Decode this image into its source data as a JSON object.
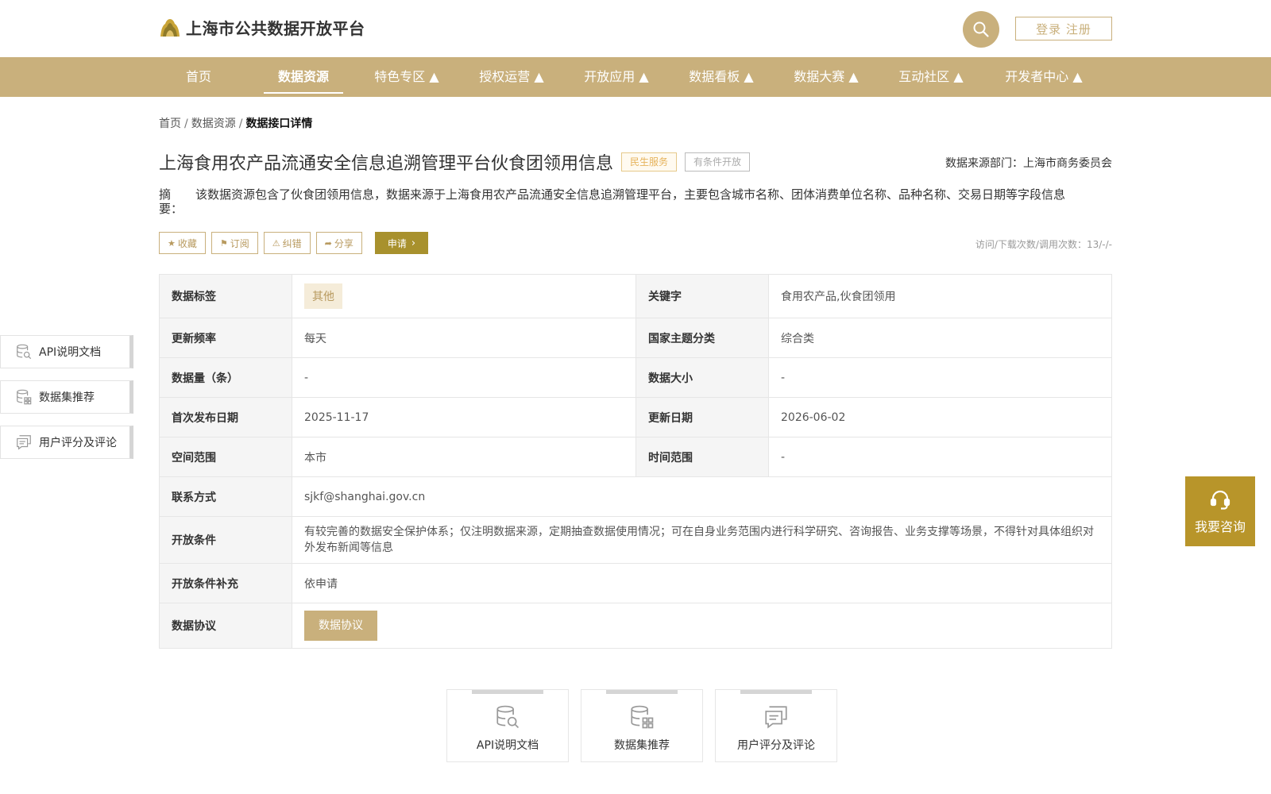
{
  "header": {
    "logo_text": "上海市公共数据开放平台",
    "login_label": "登录 注册"
  },
  "nav": {
    "items": [
      {
        "label": "首页"
      },
      {
        "label": "数据资源"
      },
      {
        "label": "特色专区 ▲"
      },
      {
        "label": "授权运营 ▲"
      },
      {
        "label": "开放应用 ▲"
      },
      {
        "label": "数据看板 ▲"
      },
      {
        "label": "数据大赛 ▲"
      },
      {
        "label": "互动社区 ▲"
      },
      {
        "label": "开发者中心 ▲"
      }
    ]
  },
  "breadcrumb": {
    "home": "首页",
    "resources": "数据资源",
    "current": "数据接口详情",
    "separator": "/"
  },
  "detail": {
    "title": "上海食用农产品流通安全信息追溯管理平台伙食团领用信息",
    "tag_service": "民生服务",
    "tag_open": "有条件开放",
    "source": "数据来源部门：上海市商务委员会",
    "summary_label": "摘 要：",
    "summary_text": "该数据资源包含了伙食团领用信息，数据来源于上海食用农产品流通安全信息追溯管理平台，主要包含城市名称、团体消费单位名称、品种名称、交易日期等字段信息",
    "stats": "访问/下载次数/调用次数：13/-/-"
  },
  "actions": {
    "favorite": "收藏",
    "subscribe": "订阅",
    "report": "纠错",
    "share": "分享",
    "apply": "申请"
  },
  "table": {
    "tag_label": "数据标签",
    "tag_value": "其他",
    "keyword_label": "关键字",
    "keyword_value": "食用农产品,伙食团领用",
    "freq_label": "更新频率",
    "freq_value": "每天",
    "theme_label": "国家主题分类",
    "theme_value": "综合类",
    "count_label": "数据量（条）",
    "count_value": "-",
    "size_label": "数据大小",
    "size_value": "-",
    "first_label": "首次发布日期",
    "first_value": "2025-11-17",
    "update_label": "更新日期",
    "update_value": "2026-06-02",
    "space_label": "空间范围",
    "space_value": "本市",
    "time_label": "时间范围",
    "time_value": "-",
    "contact_label": "联系方式",
    "contact_value": "sjkf@shanghai.gov.cn",
    "cond_label": "开放条件",
    "cond_value": "有较完善的数据安全保护体系；仅注明数据来源，定期抽查数据使用情况；可在自身业务范围内进行科学研究、咨询报告、业务支撑等场景，不得针对具体组织对外发布新闻等信息",
    "cond_extra_label": "开放条件补充",
    "cond_extra_value": "依申请",
    "agree_label": "数据协议",
    "agree_button": "数据协议"
  },
  "side_menu": {
    "api_doc": "API说明文档",
    "dataset_rec": "数据集推荐",
    "rating": "用户评分及评论"
  },
  "consult": {
    "label": "我要咨询"
  },
  "cards": {
    "api_doc": "API说明文档",
    "dataset_rec": "数据集推荐",
    "rating": "用户评分及评论"
  },
  "colors": {
    "brand": "#c9b07c",
    "apply": "#a8912d",
    "consult": "#b8952a"
  }
}
